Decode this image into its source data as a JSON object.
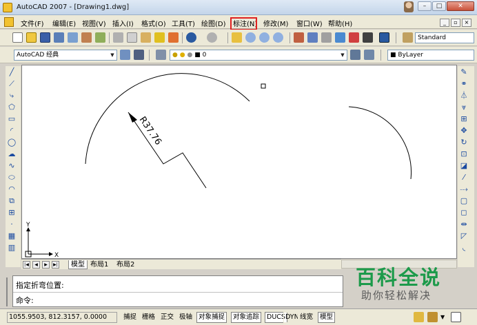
{
  "window": {
    "title": "AutoCAD 2007 - [Drawing1.dwg]",
    "min": "–",
    "max": "□",
    "close": "✕"
  },
  "menu": {
    "items": [
      "文件(F)",
      "编辑(E)",
      "视图(V)",
      "插入(I)",
      "格式(O)",
      "工具(T)",
      "绘图(D)",
      "标注(N)",
      "修改(M)",
      "窗口(W)",
      "帮助(H)"
    ],
    "highlighted": "标注(N)",
    "mdi_min": "_",
    "mdi_max": "▫",
    "mdi_close": "×"
  },
  "toolbar": {
    "text_style": "Standard",
    "workspace": "AutoCAD 经典",
    "layer": "0",
    "color": "ByLayer"
  },
  "drawing": {
    "dimension_text": "R37.76",
    "ucs_y": "Y",
    "ucs_x": "X"
  },
  "tabs": {
    "model": "模型",
    "layout1": "布局1",
    "layout2": "布局2"
  },
  "command": {
    "prompt": "指定折弯位置:",
    "input_label": "命令:"
  },
  "status": {
    "coords": "1055.9503, 812.3157, 0.0000",
    "buttons": [
      {
        "label": "捕捉",
        "on": false
      },
      {
        "label": "栅格",
        "on": false
      },
      {
        "label": "正交",
        "on": false
      },
      {
        "label": "极轴",
        "on": false
      },
      {
        "label": "对象捕捉",
        "on": true
      },
      {
        "label": "对象追踪",
        "on": true
      },
      {
        "label": "DUCS",
        "on": true
      },
      {
        "label": "DYN",
        "on": false
      },
      {
        "label": "线宽",
        "on": false
      },
      {
        "label": "模型",
        "on": true
      }
    ]
  },
  "watermark": {
    "title": "百科全说",
    "subtitle": "助你轻松解决"
  },
  "colors": {
    "accent_highlight": "#e02020",
    "watermark_green": "#1c9a4a"
  }
}
